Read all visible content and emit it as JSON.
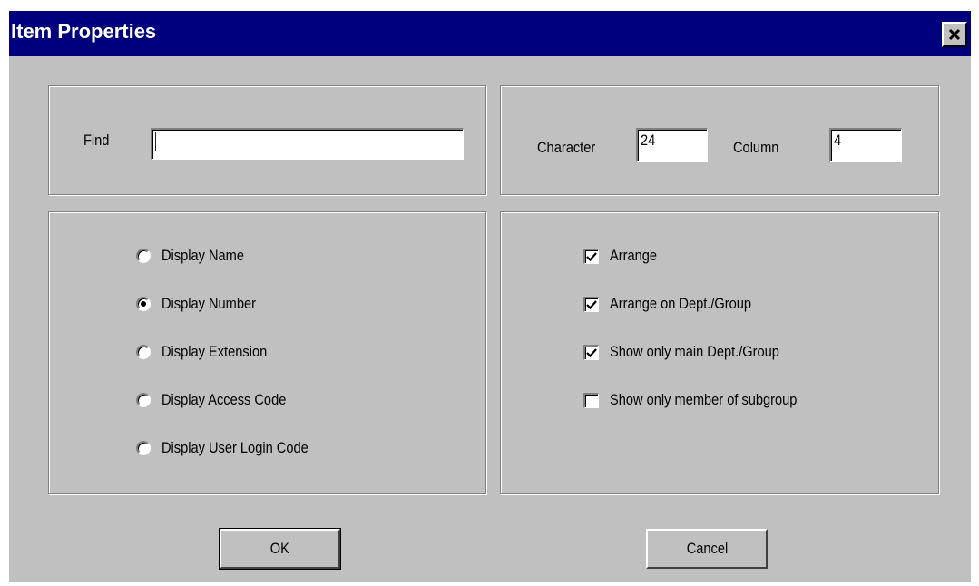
{
  "window": {
    "title": "Item Properties"
  },
  "find": {
    "label": "Find",
    "value": ""
  },
  "layout": {
    "character_label": "Character",
    "character_value": "24",
    "column_label": "Column",
    "column_value": "4"
  },
  "display_options": [
    {
      "label": "Display  Name",
      "selected": false
    },
    {
      "label": "Display  Number",
      "selected": true
    },
    {
      "label": "Display  Extension",
      "selected": false
    },
    {
      "label": "Display  Access Code",
      "selected": false
    },
    {
      "label": "Display  User Login Code",
      "selected": false
    }
  ],
  "arrange_options": [
    {
      "label": "Arrange",
      "checked": true
    },
    {
      "label": "Arrange on Dept./Group",
      "checked": true
    },
    {
      "label": "Show only main Dept./Group",
      "checked": true
    },
    {
      "label": "Show only member of subgroup",
      "checked": false
    }
  ],
  "buttons": {
    "ok_label": "OK",
    "cancel_label": "Cancel"
  }
}
